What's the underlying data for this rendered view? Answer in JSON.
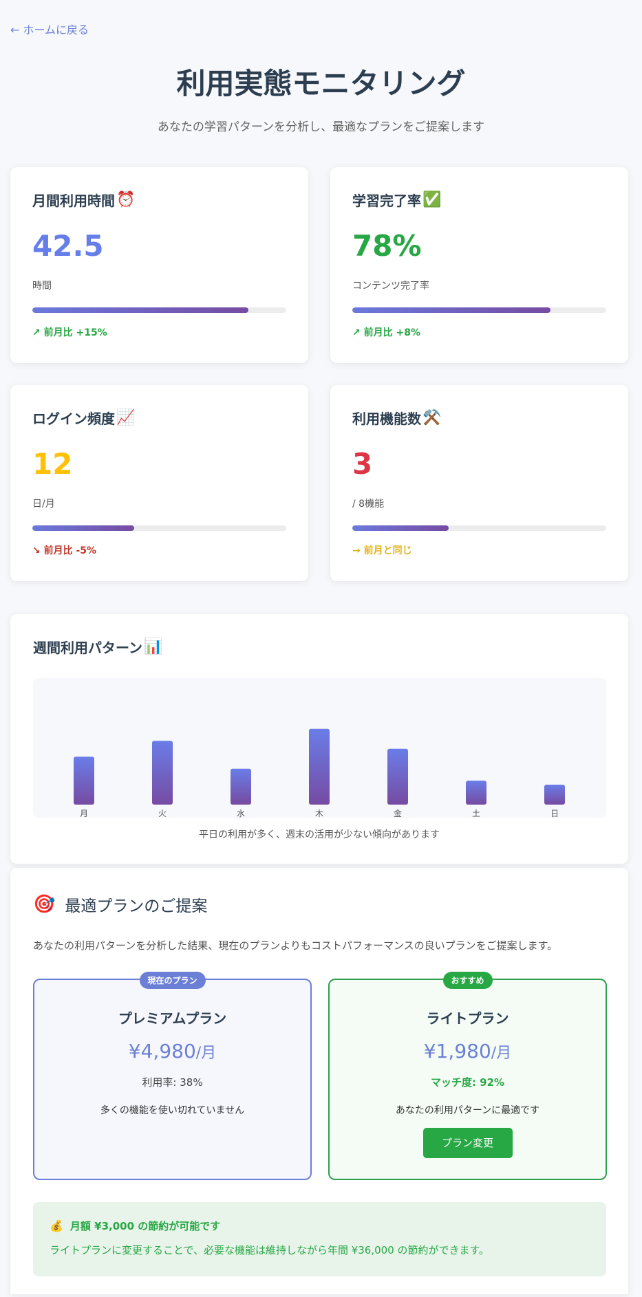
{
  "nav": {
    "back_label": "← ホームに戻る"
  },
  "header": {
    "title": "利用実態モニタリング",
    "subtitle": "あなたの学習パターンを分析し、最適なプランをご提案します"
  },
  "metrics": [
    {
      "title": "月間利用時間",
      "icon": "alarm-clock-icon",
      "emoji": "⏰",
      "value": "42.5",
      "unit": "時間",
      "progress": 0.85,
      "trend": "↗ 前月比 +15%",
      "trend_dir": "up",
      "color": "#667eea"
    },
    {
      "title": "学習完了率",
      "icon": "check-mark-icon",
      "emoji": "✅",
      "value": "78%",
      "unit": "コンテンツ完了率",
      "progress": 0.78,
      "trend": "↗ 前月比 +8%",
      "trend_dir": "up",
      "color": "#28a745"
    },
    {
      "title": "ログイン頻度",
      "icon": "chart-increasing-icon",
      "emoji": "📈",
      "value": "12",
      "unit": "日/月",
      "progress": 0.4,
      "trend": "↘ 前月比 -5%",
      "trend_dir": "down",
      "color": "#ffc107"
    },
    {
      "title": "利用機能数",
      "icon": "tools-icon",
      "emoji": "⚒️",
      "value": "3",
      "unit": "/ 8機能",
      "progress": 0.38,
      "trend": "→ 前月と同じ",
      "trend_dir": "flat",
      "color": "#dc3545"
    }
  ],
  "weekly": {
    "title": "週間利用パターン",
    "icon": "bar-chart-icon",
    "emoji": "📊",
    "note": "平日の利用が多く、週末の活用が少ない傾向があります"
  },
  "chart_data": {
    "type": "bar",
    "categories": [
      "月",
      "火",
      "水",
      "木",
      "金",
      "土",
      "日"
    ],
    "values": [
      60,
      80,
      45,
      95,
      70,
      30,
      25
    ],
    "ylim": [
      0,
      100
    ],
    "grid": false
  },
  "suggestion": {
    "icon": "target-icon",
    "emoji": "🎯",
    "title": "最適プランのご提案",
    "desc": "あなたの利用パターンを分析した結果、現在のプランよりもコストパフォーマンスの良いプランをご提案します。",
    "current": {
      "badge": "現在のプラン",
      "name": "プレミアムプラン",
      "price": "¥4,980",
      "per": "/月",
      "stat": "利用率: 38%",
      "note": "多くの機能を使い切れていません"
    },
    "recommended": {
      "badge": "おすすめ",
      "name": "ライトプラン",
      "price": "¥1,980",
      "per": "/月",
      "stat": "マッチ度: 92%",
      "note": "あなたの利用パターンに最適です",
      "button": "プラン変更"
    },
    "savings": {
      "icon": "money-bag-icon",
      "emoji": "💰",
      "headline": "月額 ¥3,000 の節約が可能です",
      "detail": "ライトプランに変更することで、必要な機能は維持しながら年間 ¥36,000 の節約ができます。"
    }
  }
}
